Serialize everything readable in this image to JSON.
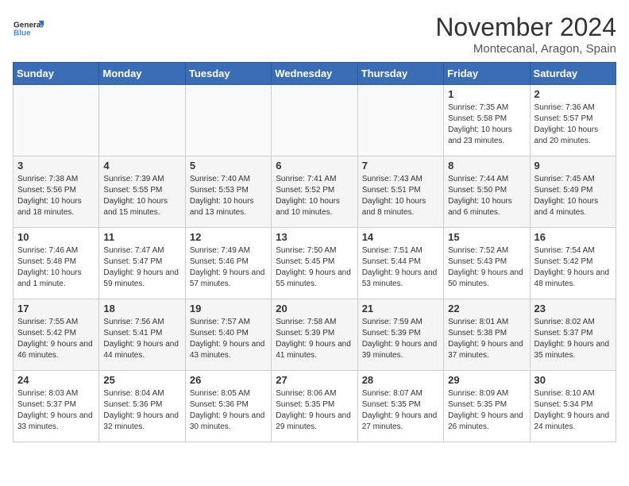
{
  "logo": {
    "line1": "General",
    "line2": "Blue"
  },
  "title": "November 2024",
  "location": "Montecanal, Aragon, Spain",
  "days_of_week": [
    "Sunday",
    "Monday",
    "Tuesday",
    "Wednesday",
    "Thursday",
    "Friday",
    "Saturday"
  ],
  "weeks": [
    [
      {
        "day": "",
        "info": ""
      },
      {
        "day": "",
        "info": ""
      },
      {
        "day": "",
        "info": ""
      },
      {
        "day": "",
        "info": ""
      },
      {
        "day": "",
        "info": ""
      },
      {
        "day": "1",
        "info": "Sunrise: 7:35 AM\nSunset: 5:58 PM\nDaylight: 10 hours and 23 minutes."
      },
      {
        "day": "2",
        "info": "Sunrise: 7:36 AM\nSunset: 5:57 PM\nDaylight: 10 hours and 20 minutes."
      }
    ],
    [
      {
        "day": "3",
        "info": "Sunrise: 7:38 AM\nSunset: 5:56 PM\nDaylight: 10 hours and 18 minutes."
      },
      {
        "day": "4",
        "info": "Sunrise: 7:39 AM\nSunset: 5:55 PM\nDaylight: 10 hours and 15 minutes."
      },
      {
        "day": "5",
        "info": "Sunrise: 7:40 AM\nSunset: 5:53 PM\nDaylight: 10 hours and 13 minutes."
      },
      {
        "day": "6",
        "info": "Sunrise: 7:41 AM\nSunset: 5:52 PM\nDaylight: 10 hours and 10 minutes."
      },
      {
        "day": "7",
        "info": "Sunrise: 7:43 AM\nSunset: 5:51 PM\nDaylight: 10 hours and 8 minutes."
      },
      {
        "day": "8",
        "info": "Sunrise: 7:44 AM\nSunset: 5:50 PM\nDaylight: 10 hours and 6 minutes."
      },
      {
        "day": "9",
        "info": "Sunrise: 7:45 AM\nSunset: 5:49 PM\nDaylight: 10 hours and 4 minutes."
      }
    ],
    [
      {
        "day": "10",
        "info": "Sunrise: 7:46 AM\nSunset: 5:48 PM\nDaylight: 10 hours and 1 minute."
      },
      {
        "day": "11",
        "info": "Sunrise: 7:47 AM\nSunset: 5:47 PM\nDaylight: 9 hours and 59 minutes."
      },
      {
        "day": "12",
        "info": "Sunrise: 7:49 AM\nSunset: 5:46 PM\nDaylight: 9 hours and 57 minutes."
      },
      {
        "day": "13",
        "info": "Sunrise: 7:50 AM\nSunset: 5:45 PM\nDaylight: 9 hours and 55 minutes."
      },
      {
        "day": "14",
        "info": "Sunrise: 7:51 AM\nSunset: 5:44 PM\nDaylight: 9 hours and 53 minutes."
      },
      {
        "day": "15",
        "info": "Sunrise: 7:52 AM\nSunset: 5:43 PM\nDaylight: 9 hours and 50 minutes."
      },
      {
        "day": "16",
        "info": "Sunrise: 7:54 AM\nSunset: 5:42 PM\nDaylight: 9 hours and 48 minutes."
      }
    ],
    [
      {
        "day": "17",
        "info": "Sunrise: 7:55 AM\nSunset: 5:42 PM\nDaylight: 9 hours and 46 minutes."
      },
      {
        "day": "18",
        "info": "Sunrise: 7:56 AM\nSunset: 5:41 PM\nDaylight: 9 hours and 44 minutes."
      },
      {
        "day": "19",
        "info": "Sunrise: 7:57 AM\nSunset: 5:40 PM\nDaylight: 9 hours and 43 minutes."
      },
      {
        "day": "20",
        "info": "Sunrise: 7:58 AM\nSunset: 5:39 PM\nDaylight: 9 hours and 41 minutes."
      },
      {
        "day": "21",
        "info": "Sunrise: 7:59 AM\nSunset: 5:39 PM\nDaylight: 9 hours and 39 minutes."
      },
      {
        "day": "22",
        "info": "Sunrise: 8:01 AM\nSunset: 5:38 PM\nDaylight: 9 hours and 37 minutes."
      },
      {
        "day": "23",
        "info": "Sunrise: 8:02 AM\nSunset: 5:37 PM\nDaylight: 9 hours and 35 minutes."
      }
    ],
    [
      {
        "day": "24",
        "info": "Sunrise: 8:03 AM\nSunset: 5:37 PM\nDaylight: 9 hours and 33 minutes."
      },
      {
        "day": "25",
        "info": "Sunrise: 8:04 AM\nSunset: 5:36 PM\nDaylight: 9 hours and 32 minutes."
      },
      {
        "day": "26",
        "info": "Sunrise: 8:05 AM\nSunset: 5:36 PM\nDaylight: 9 hours and 30 minutes."
      },
      {
        "day": "27",
        "info": "Sunrise: 8:06 AM\nSunset: 5:35 PM\nDaylight: 9 hours and 29 minutes."
      },
      {
        "day": "28",
        "info": "Sunrise: 8:07 AM\nSunset: 5:35 PM\nDaylight: 9 hours and 27 minutes."
      },
      {
        "day": "29",
        "info": "Sunrise: 8:09 AM\nSunset: 5:35 PM\nDaylight: 9 hours and 26 minutes."
      },
      {
        "day": "30",
        "info": "Sunrise: 8:10 AM\nSunset: 5:34 PM\nDaylight: 9 hours and 24 minutes."
      }
    ]
  ]
}
